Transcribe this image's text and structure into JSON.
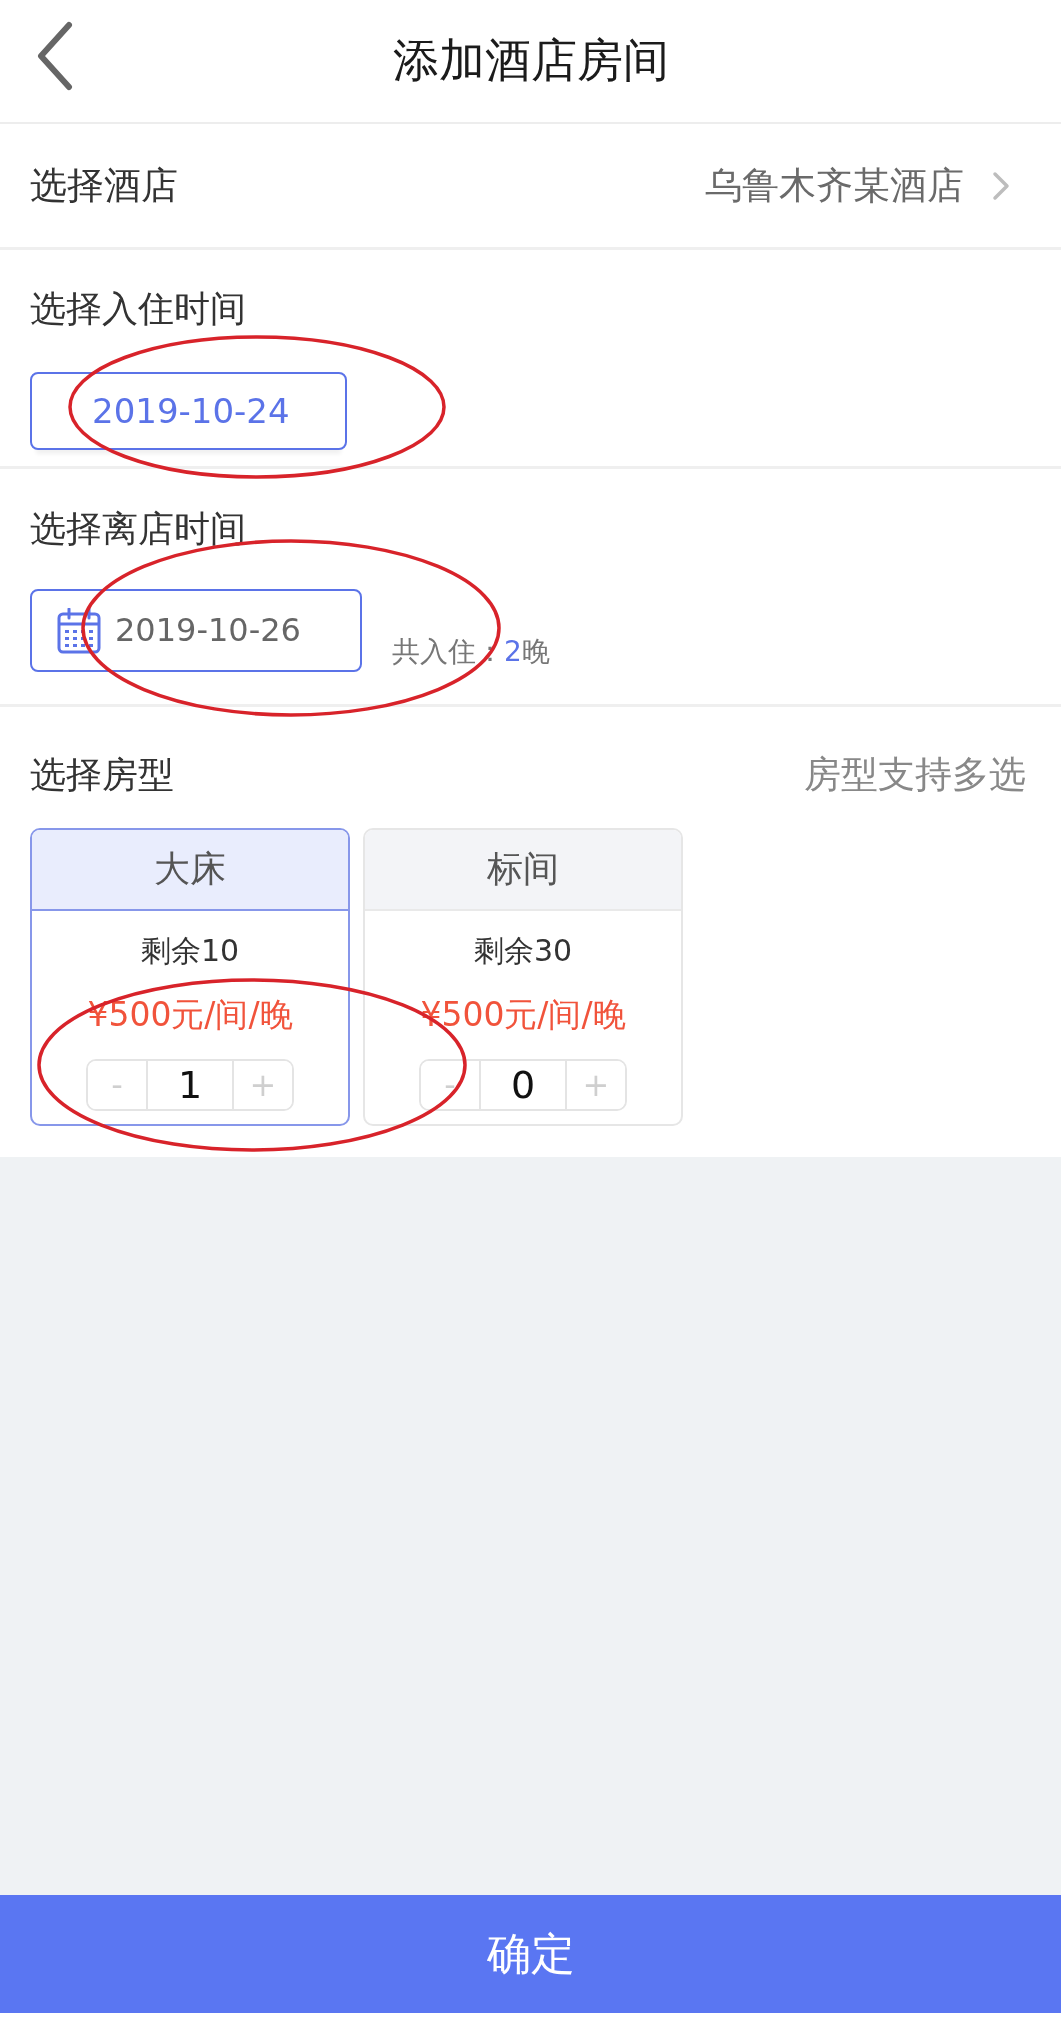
{
  "header": {
    "title": "添加酒店房间"
  },
  "hotel": {
    "label": "选择酒店",
    "value": "乌鲁木齐某酒店"
  },
  "check_in": {
    "label": "选择入住时间",
    "date": "2019-10-24",
    "active": true,
    "circled": true
  },
  "check_out": {
    "label": "选择离店时间",
    "date": "2019-10-26",
    "active": false,
    "calendar_icon": true,
    "circled": true,
    "nights_prefix": "共入住：",
    "nights": "2",
    "nights_suffix": "晚"
  },
  "room_types": {
    "label": "选择房型",
    "hint": "房型支持多选",
    "items": [
      {
        "name": "大床",
        "remaining": "剩余10",
        "price": "¥500元/间/晚",
        "decrement": "-",
        "quantity": "1",
        "increment": "+",
        "selected": true,
        "circled": true
      },
      {
        "name": "标间",
        "remaining": "剩余30",
        "price": "¥500元/间/晚",
        "decrement": "-",
        "quantity": "0",
        "increment": "+",
        "selected": false,
        "circled": false
      }
    ]
  },
  "confirm_button": {
    "label": "确定"
  }
}
